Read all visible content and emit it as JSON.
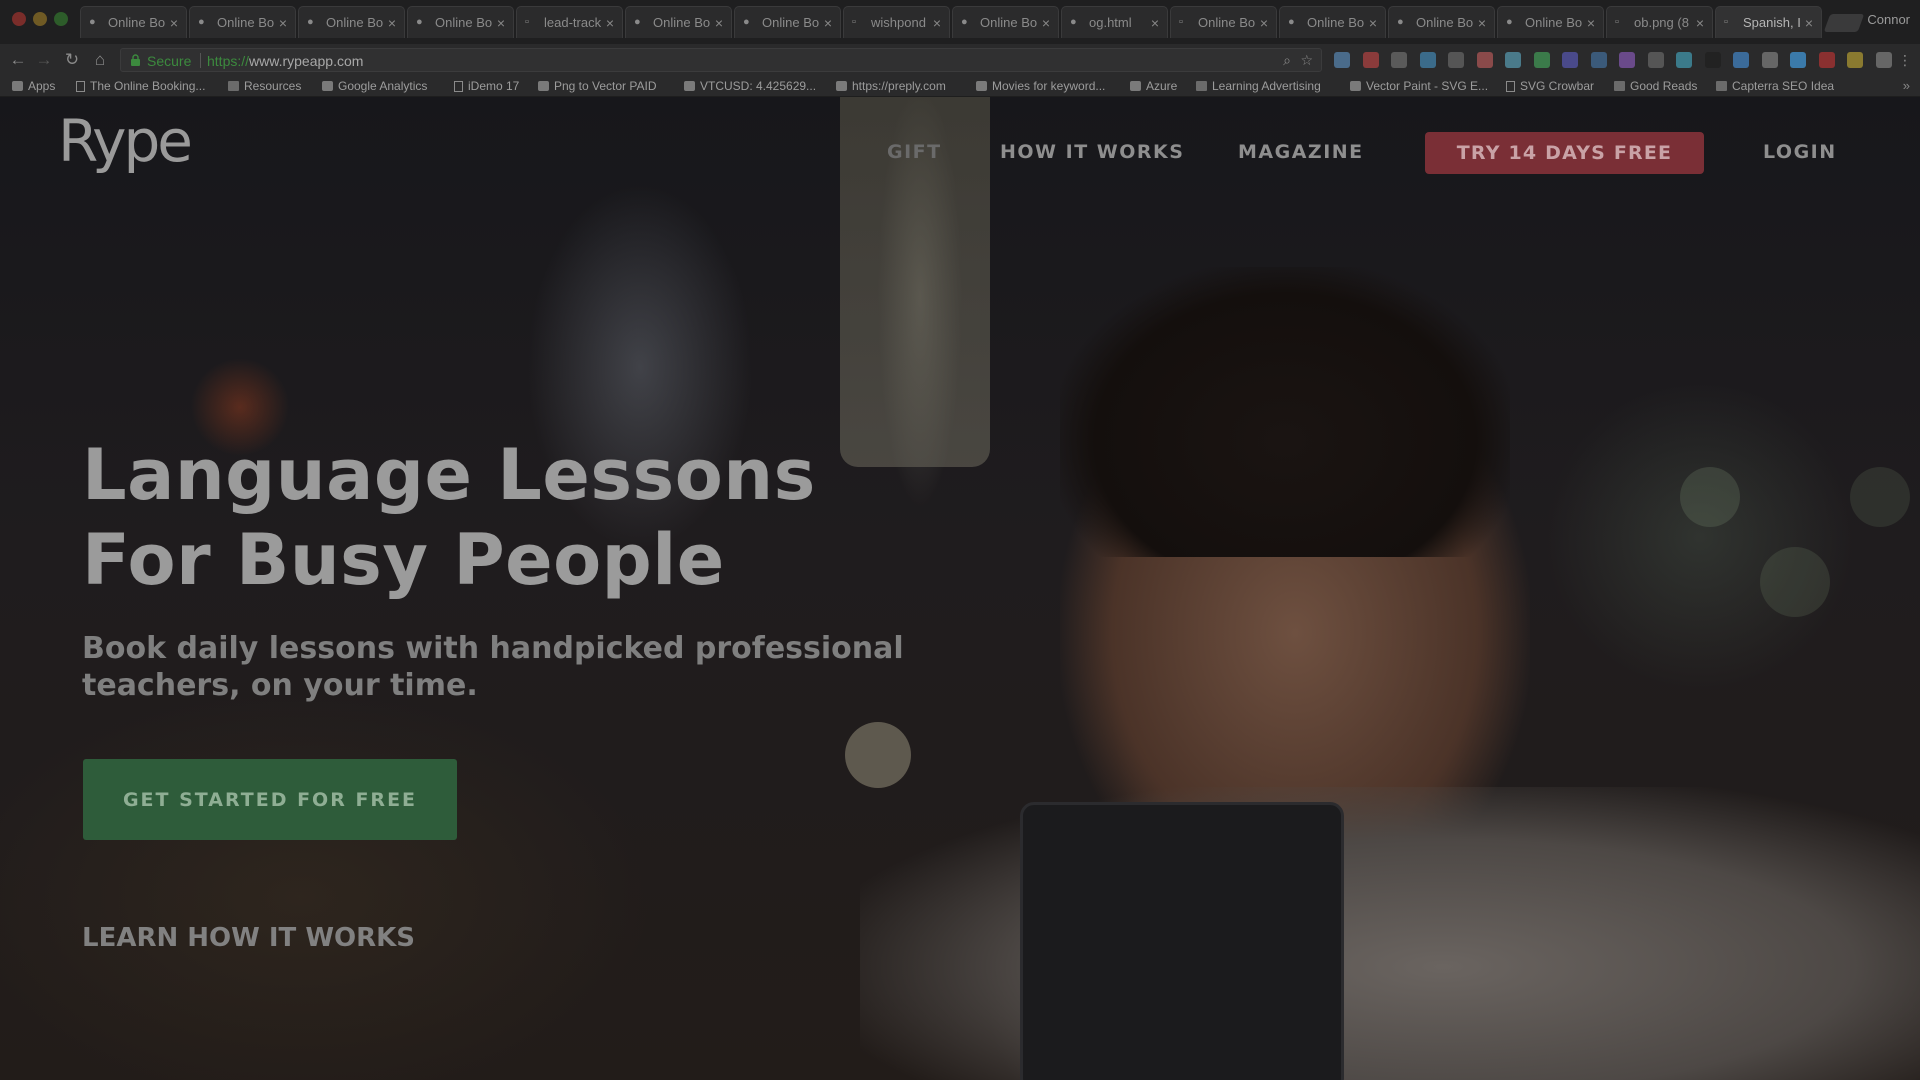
{
  "browser": {
    "tabs": [
      {
        "title": "Online Bo",
        "icon": "panda-icon"
      },
      {
        "title": "Online Bo",
        "icon": "panda-icon"
      },
      {
        "title": "Online Bo",
        "icon": "panda-icon"
      },
      {
        "title": "Online Bo",
        "icon": "panda-icon"
      },
      {
        "title": "lead-track",
        "icon": "page-icon"
      },
      {
        "title": "Online Bo",
        "icon": "panda-icon"
      },
      {
        "title": "Online Bo",
        "icon": "panda-icon"
      },
      {
        "title": "wishpond",
        "icon": "page-icon"
      },
      {
        "title": "Online Bo",
        "icon": "panda-icon"
      },
      {
        "title": "og.html",
        "icon": "panda-icon"
      },
      {
        "title": "Online Bo",
        "icon": "page-icon"
      },
      {
        "title": "Online Bo",
        "icon": "panda-icon"
      },
      {
        "title": "Online Bo",
        "icon": "panda-icon"
      },
      {
        "title": "Online Bo",
        "icon": "panda-icon"
      },
      {
        "title": "ob.png (8",
        "icon": "page-icon"
      },
      {
        "title": "Spanish, I",
        "icon": "page-icon",
        "active": true
      }
    ],
    "profile_name": "Connor",
    "address": {
      "secure_label": "Secure",
      "url_scheme": "https://",
      "url_host": "www.rypeapp.com"
    },
    "bookmarks": [
      {
        "label": "Apps",
        "icon": "apps-grid-icon"
      },
      {
        "label": "The Online Booking...",
        "icon": "page-icon"
      },
      {
        "label": "Resources",
        "icon": "folder-icon"
      },
      {
        "label": "Google Analytics",
        "icon": "analytics-icon"
      },
      {
        "label": "iDemo 17",
        "icon": "page-icon"
      },
      {
        "label": "Png to Vector PAID",
        "icon": "image-icon"
      },
      {
        "label": "VTCUSD: 4.425629...",
        "icon": "cloud-icon"
      },
      {
        "label": "https://preply.com",
        "icon": "preply-icon"
      },
      {
        "label": "Movies for keyword...",
        "icon": "play-icon"
      },
      {
        "label": "Azure",
        "icon": "azure-icon"
      },
      {
        "label": "Learning Advertising",
        "icon": "folder-icon"
      },
      {
        "label": "Vector Paint - SVG E...",
        "icon": "vector-paint-icon"
      },
      {
        "label": "SVG Crowbar",
        "icon": "page-icon"
      },
      {
        "label": "Good Reads",
        "icon": "folder-icon"
      },
      {
        "label": "Capterra SEO Idea",
        "icon": "folder-icon"
      }
    ],
    "bookmarks_more": "»"
  },
  "site": {
    "logo": "Rype",
    "nav": {
      "gift": "GIFT",
      "how_it_works": "HOW IT WORKS",
      "magazine": "MAGAZINE",
      "trial": "TRY 14 DAYS FREE",
      "login": "LOGIN"
    },
    "hero": {
      "title_line1": "Language Lessons",
      "title_line2": "For Busy People",
      "subtitle_line1": "Book daily lessons with handpicked professional",
      "subtitle_line2": "teachers, on your time.",
      "cta": "GET STARTED FOR FREE",
      "learn_link": "LEARN HOW IT WORKS"
    }
  },
  "colors": {
    "trial_button": "#7a2f36",
    "start_button": "#2e5c3a",
    "secure_green": "#3c8a3e"
  }
}
